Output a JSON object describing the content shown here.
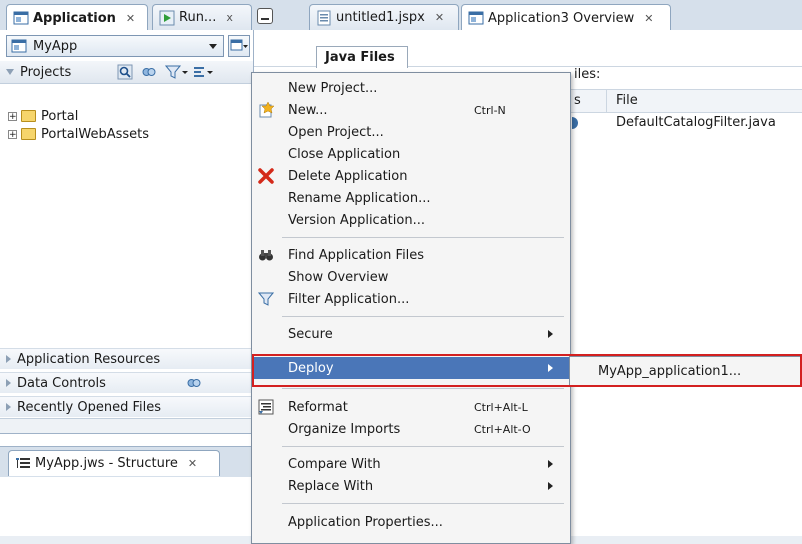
{
  "tabs": {
    "application": "Application",
    "run": "Run...",
    "untitled": "untitled1.jspx",
    "overview": "Application3 Overview"
  },
  "left": {
    "app_name": "MyApp",
    "projects_label": "Projects",
    "tree": [
      "Portal",
      "PortalWebAssets"
    ],
    "sections": [
      "Application Resources",
      "Data Controls",
      "Recently Opened Files"
    ],
    "structure_tab": "MyApp.jws - Structure"
  },
  "editor": {
    "java_files_tab": "Java Files",
    "files_label": "iles:",
    "col_s": "s",
    "col_file": "File",
    "row_file": "DefaultCatalogFilter.java"
  },
  "menu": {
    "items": [
      {
        "label": "New Project..."
      },
      {
        "label": "New...",
        "accel": "Ctrl-N"
      },
      {
        "label": "Open Project..."
      },
      {
        "label": "Close Application"
      },
      {
        "label": "Delete Application"
      },
      {
        "label": "Rename Application..."
      },
      {
        "label": "Version Application..."
      },
      {
        "label": "Find Application Files"
      },
      {
        "label": "Show Overview"
      },
      {
        "label": "Filter Application..."
      },
      {
        "label": "Secure"
      },
      {
        "label": "Deploy"
      },
      {
        "label": "Reformat",
        "accel": "Ctrl+Alt-L"
      },
      {
        "label": "Organize Imports",
        "accel": "Ctrl+Alt-O"
      },
      {
        "label": "Compare With"
      },
      {
        "label": "Replace With"
      },
      {
        "label": "Application Properties..."
      }
    ]
  },
  "submenu": {
    "deploy_target": "MyApp_application1..."
  },
  "colors": {
    "highlight": "#4a76b8",
    "callout": "#d32020"
  }
}
